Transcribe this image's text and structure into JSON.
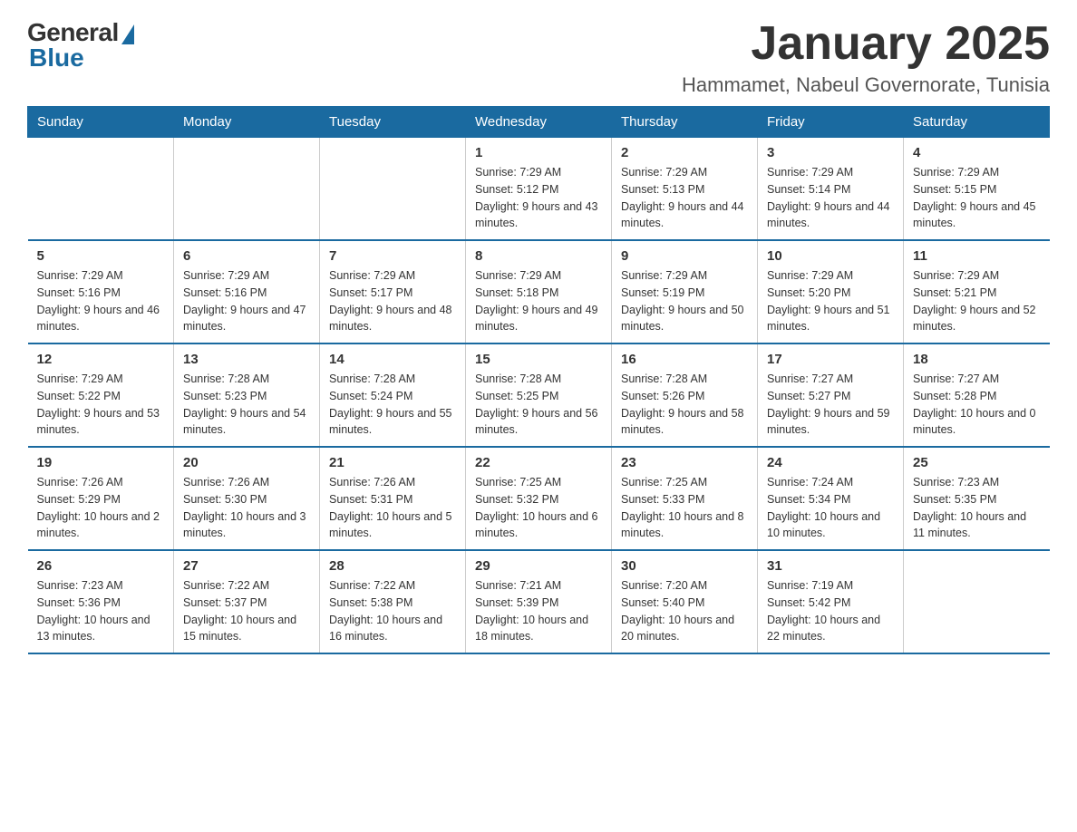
{
  "logo": {
    "general": "General",
    "blue": "Blue"
  },
  "title": "January 2025",
  "location": "Hammamet, Nabeul Governorate, Tunisia",
  "days_header": [
    "Sunday",
    "Monday",
    "Tuesday",
    "Wednesday",
    "Thursday",
    "Friday",
    "Saturday"
  ],
  "weeks": [
    [
      {
        "day": "",
        "info": ""
      },
      {
        "day": "",
        "info": ""
      },
      {
        "day": "",
        "info": ""
      },
      {
        "day": "1",
        "info": "Sunrise: 7:29 AM\nSunset: 5:12 PM\nDaylight: 9 hours and 43 minutes."
      },
      {
        "day": "2",
        "info": "Sunrise: 7:29 AM\nSunset: 5:13 PM\nDaylight: 9 hours and 44 minutes."
      },
      {
        "day": "3",
        "info": "Sunrise: 7:29 AM\nSunset: 5:14 PM\nDaylight: 9 hours and 44 minutes."
      },
      {
        "day": "4",
        "info": "Sunrise: 7:29 AM\nSunset: 5:15 PM\nDaylight: 9 hours and 45 minutes."
      }
    ],
    [
      {
        "day": "5",
        "info": "Sunrise: 7:29 AM\nSunset: 5:16 PM\nDaylight: 9 hours and 46 minutes."
      },
      {
        "day": "6",
        "info": "Sunrise: 7:29 AM\nSunset: 5:16 PM\nDaylight: 9 hours and 47 minutes."
      },
      {
        "day": "7",
        "info": "Sunrise: 7:29 AM\nSunset: 5:17 PM\nDaylight: 9 hours and 48 minutes."
      },
      {
        "day": "8",
        "info": "Sunrise: 7:29 AM\nSunset: 5:18 PM\nDaylight: 9 hours and 49 minutes."
      },
      {
        "day": "9",
        "info": "Sunrise: 7:29 AM\nSunset: 5:19 PM\nDaylight: 9 hours and 50 minutes."
      },
      {
        "day": "10",
        "info": "Sunrise: 7:29 AM\nSunset: 5:20 PM\nDaylight: 9 hours and 51 minutes."
      },
      {
        "day": "11",
        "info": "Sunrise: 7:29 AM\nSunset: 5:21 PM\nDaylight: 9 hours and 52 minutes."
      }
    ],
    [
      {
        "day": "12",
        "info": "Sunrise: 7:29 AM\nSunset: 5:22 PM\nDaylight: 9 hours and 53 minutes."
      },
      {
        "day": "13",
        "info": "Sunrise: 7:28 AM\nSunset: 5:23 PM\nDaylight: 9 hours and 54 minutes."
      },
      {
        "day": "14",
        "info": "Sunrise: 7:28 AM\nSunset: 5:24 PM\nDaylight: 9 hours and 55 minutes."
      },
      {
        "day": "15",
        "info": "Sunrise: 7:28 AM\nSunset: 5:25 PM\nDaylight: 9 hours and 56 minutes."
      },
      {
        "day": "16",
        "info": "Sunrise: 7:28 AM\nSunset: 5:26 PM\nDaylight: 9 hours and 58 minutes."
      },
      {
        "day": "17",
        "info": "Sunrise: 7:27 AM\nSunset: 5:27 PM\nDaylight: 9 hours and 59 minutes."
      },
      {
        "day": "18",
        "info": "Sunrise: 7:27 AM\nSunset: 5:28 PM\nDaylight: 10 hours and 0 minutes."
      }
    ],
    [
      {
        "day": "19",
        "info": "Sunrise: 7:26 AM\nSunset: 5:29 PM\nDaylight: 10 hours and 2 minutes."
      },
      {
        "day": "20",
        "info": "Sunrise: 7:26 AM\nSunset: 5:30 PM\nDaylight: 10 hours and 3 minutes."
      },
      {
        "day": "21",
        "info": "Sunrise: 7:26 AM\nSunset: 5:31 PM\nDaylight: 10 hours and 5 minutes."
      },
      {
        "day": "22",
        "info": "Sunrise: 7:25 AM\nSunset: 5:32 PM\nDaylight: 10 hours and 6 minutes."
      },
      {
        "day": "23",
        "info": "Sunrise: 7:25 AM\nSunset: 5:33 PM\nDaylight: 10 hours and 8 minutes."
      },
      {
        "day": "24",
        "info": "Sunrise: 7:24 AM\nSunset: 5:34 PM\nDaylight: 10 hours and 10 minutes."
      },
      {
        "day": "25",
        "info": "Sunrise: 7:23 AM\nSunset: 5:35 PM\nDaylight: 10 hours and 11 minutes."
      }
    ],
    [
      {
        "day": "26",
        "info": "Sunrise: 7:23 AM\nSunset: 5:36 PM\nDaylight: 10 hours and 13 minutes."
      },
      {
        "day": "27",
        "info": "Sunrise: 7:22 AM\nSunset: 5:37 PM\nDaylight: 10 hours and 15 minutes."
      },
      {
        "day": "28",
        "info": "Sunrise: 7:22 AM\nSunset: 5:38 PM\nDaylight: 10 hours and 16 minutes."
      },
      {
        "day": "29",
        "info": "Sunrise: 7:21 AM\nSunset: 5:39 PM\nDaylight: 10 hours and 18 minutes."
      },
      {
        "day": "30",
        "info": "Sunrise: 7:20 AM\nSunset: 5:40 PM\nDaylight: 10 hours and 20 minutes."
      },
      {
        "day": "31",
        "info": "Sunrise: 7:19 AM\nSunset: 5:42 PM\nDaylight: 10 hours and 22 minutes."
      },
      {
        "day": "",
        "info": ""
      }
    ]
  ]
}
